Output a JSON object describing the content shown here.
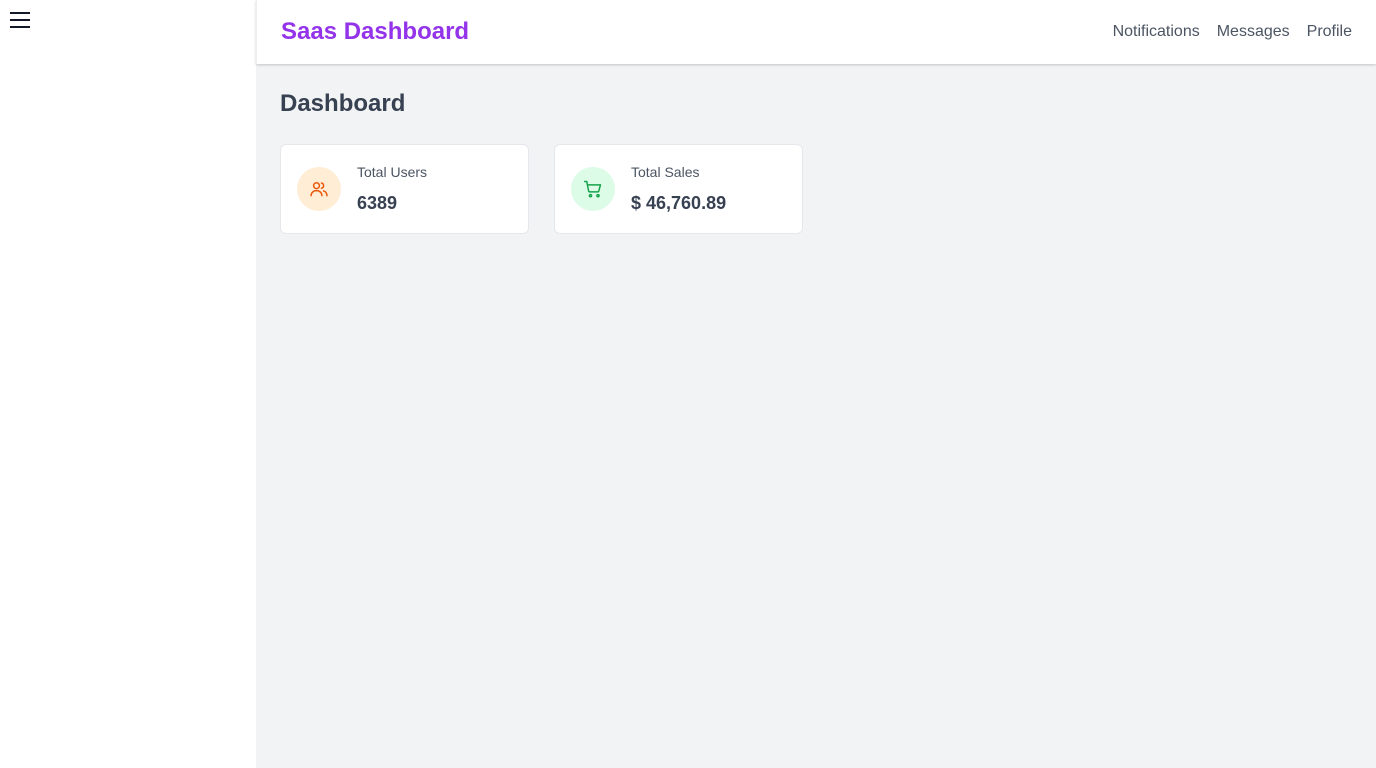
{
  "sidebar": {
    "menu_icon": "hamburger-menu-icon"
  },
  "header": {
    "brand": "Saas Dashboard",
    "nav": [
      {
        "label": "Notifications"
      },
      {
        "label": "Messages"
      },
      {
        "label": "Profile"
      }
    ]
  },
  "main": {
    "title": "Dashboard",
    "cards": [
      {
        "label": "Total Users",
        "value": "6389",
        "icon": "users-icon",
        "accent": "#ea580c",
        "icon_bg": "#ffedd5"
      },
      {
        "label": "Total Sales",
        "value": "$ 46,760.89",
        "icon": "shopping-cart-icon",
        "accent": "#16a34a",
        "icon_bg": "#dcfce7"
      }
    ]
  },
  "colors": {
    "brand": "#9333ea",
    "main_bg": "#f2f3f5",
    "text_dark": "#374151",
    "text_muted": "#4b5563"
  }
}
